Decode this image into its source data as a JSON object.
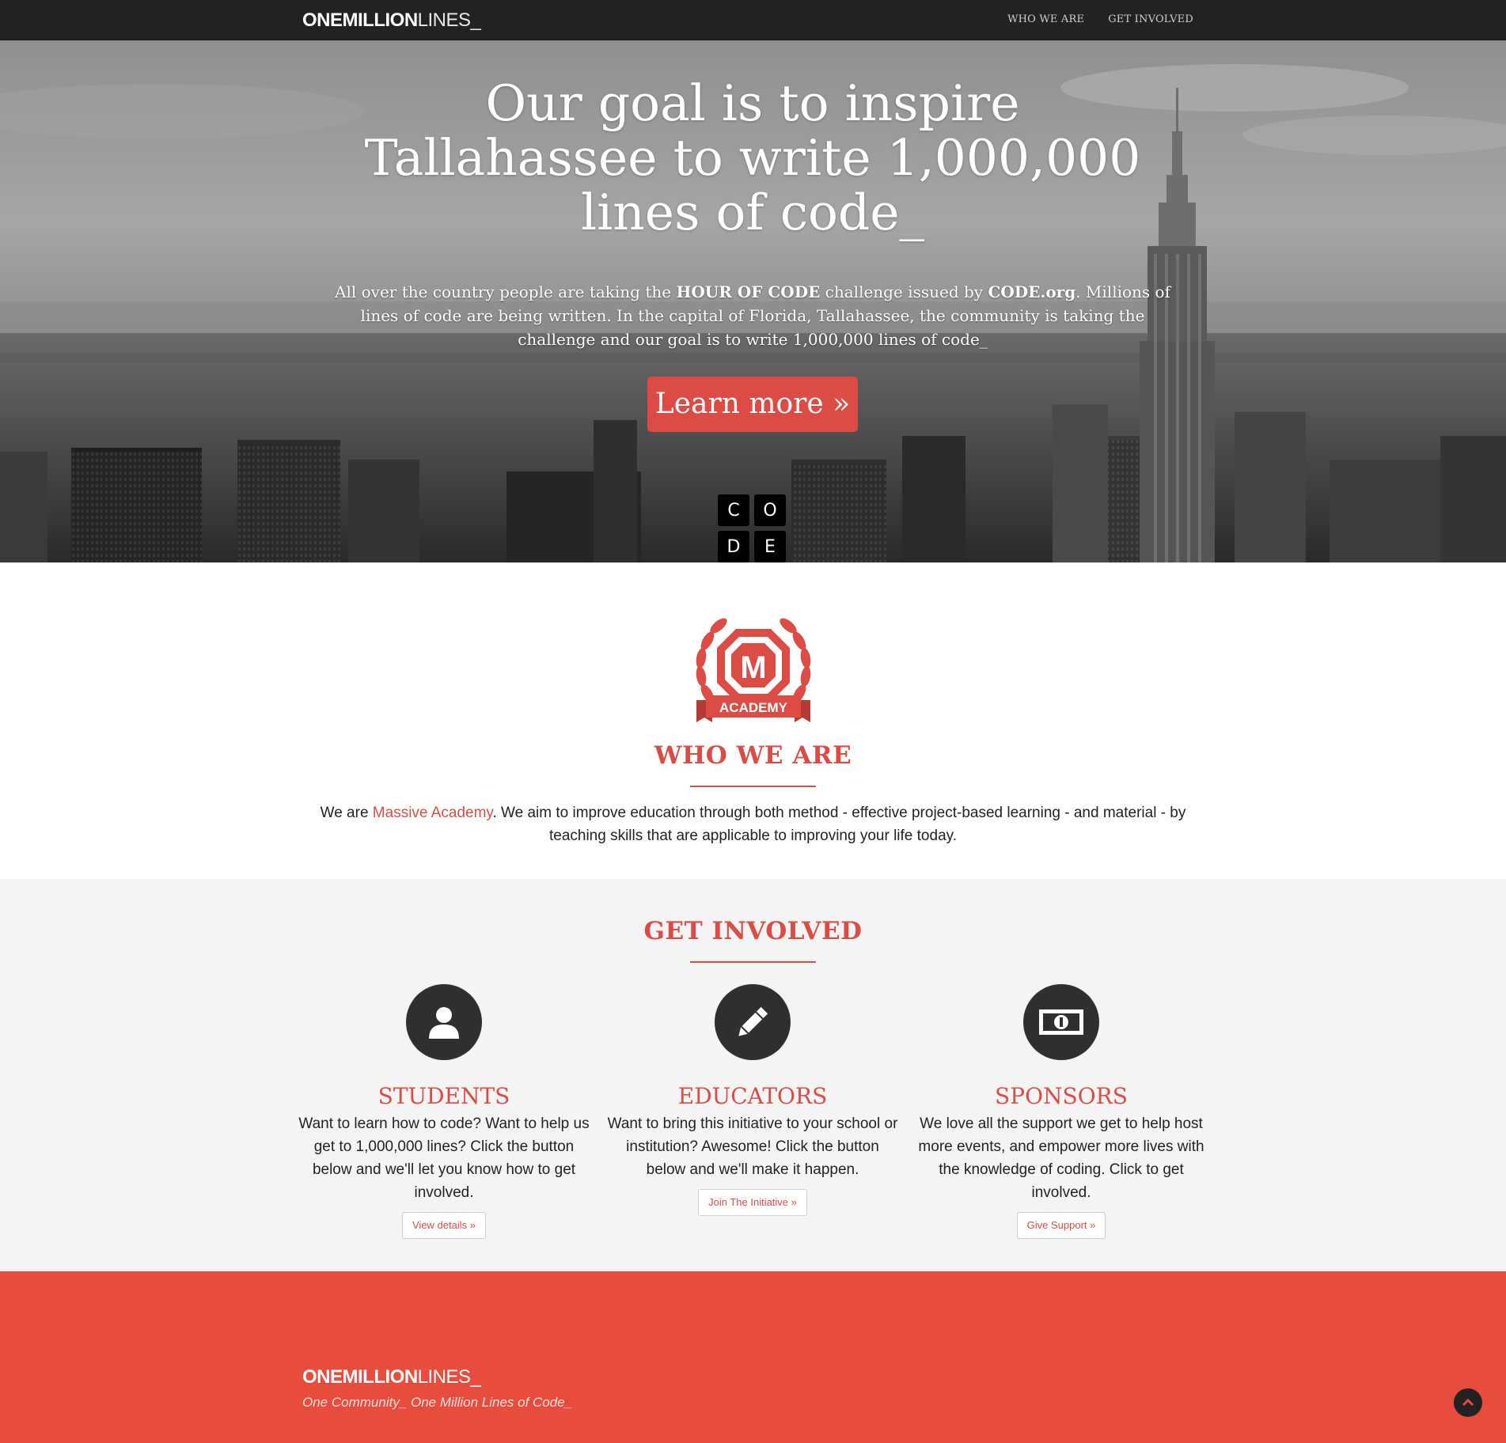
{
  "nav": {
    "brand_bold": "ONEMILLION",
    "brand_thin": "LINES_",
    "links": [
      "WHO WE ARE",
      "GET INVOLVED"
    ]
  },
  "hero": {
    "title": "Our goal is to inspire Tallahassee to write 1,000,000 lines of code_",
    "text_1": "All over the country people are taking the ",
    "text_bold_1": "HOUR OF CODE",
    "text_2": " challenge issued by ",
    "text_bold_2": "CODE.org",
    "text_3": ". Millions of lines of code are being written. In the capital of Florida, Tallahassee, the community is taking the challenge and our goal is to write 1,000,000 lines of code_",
    "button": "Learn more »",
    "code_logo": [
      "C",
      "O",
      "D",
      "E"
    ]
  },
  "who": {
    "badge_letter": "M",
    "badge_text": "ACADEMY",
    "title": "WHO WE ARE",
    "text_1": "We are ",
    "link": "Massive Academy",
    "text_2": ". We aim to improve education through both method - effective project-based learning - and material - by teaching skills that are applicable to improving your life today."
  },
  "involved": {
    "title": "GET INVOLVED",
    "columns": [
      {
        "icon": "user-icon",
        "title": "STUDENTS",
        "text": "Want to learn how to code? Want to help us get to 1,000,000 lines? Click the button below and we'll let you know how to get involved.",
        "button": "View details »"
      },
      {
        "icon": "pencil-icon",
        "title": "EDUCATORS",
        "text": "Want to bring this initiative to your school or institution? Awesome! Click the button below and we'll make it happen.",
        "button": "Join The Initiative »"
      },
      {
        "icon": "money-icon",
        "title": "SPONSORS",
        "text": "We love all the support we get to help host more events, and empower more lives with the knowledge of coding. Click to get involved.",
        "button": "Give Support »"
      }
    ]
  },
  "footer": {
    "brand_bold": "ONEMILLION",
    "brand_thin": "LINES_",
    "tagline": "One Community_ One Million Lines of Code_"
  },
  "colors": {
    "accent": "#dd4b45",
    "footer_bg": "#e74c3c",
    "nav_bg": "#222222",
    "section_bg": "#f4f4f4"
  }
}
